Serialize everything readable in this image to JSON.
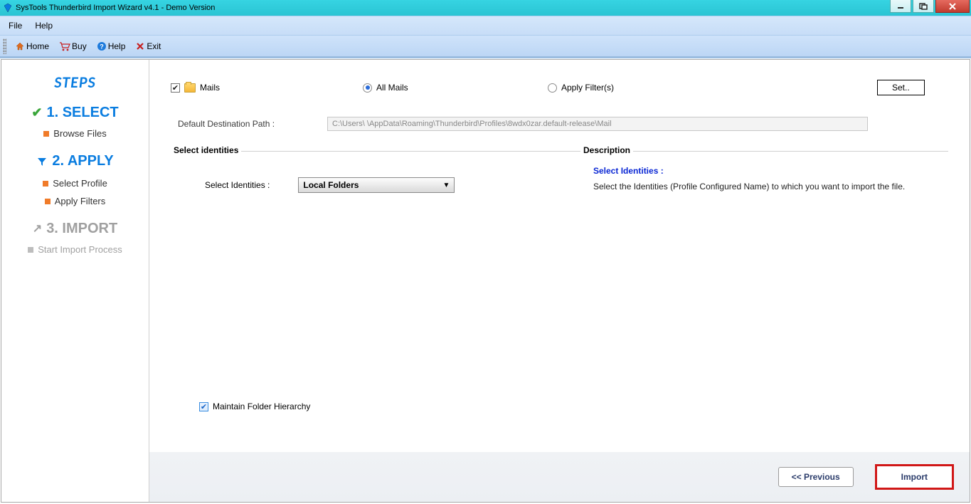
{
  "window": {
    "title": "SysTools Thunderbird Import Wizard v4.1 - Demo Version"
  },
  "menu": {
    "file": "File",
    "help": "Help"
  },
  "toolbar": {
    "home": "Home",
    "buy": "Buy",
    "help": "Help",
    "exit": "Exit"
  },
  "sidebar": {
    "steps_title": "STEPS",
    "step1": {
      "label": "1. SELECT",
      "sub1": "Browse Files"
    },
    "step2": {
      "label": "2. APPLY",
      "sub1": "Select Profile",
      "sub2": "Apply Filters"
    },
    "step3": {
      "label": "3. IMPORT",
      "sub1": "Start Import Process"
    }
  },
  "options": {
    "mails": "Mails",
    "all_mails": "All Mails",
    "apply_filters": "Apply Filter(s)",
    "set": "Set.."
  },
  "dest": {
    "label": "Default Destination Path :",
    "value": "C:\\Users\\        \\AppData\\Roaming\\Thunderbird\\Profiles\\8wdx0zar.default-release\\Mail"
  },
  "identities": {
    "legend": "Select identities",
    "label": "Select Identities :",
    "combo": "Local Folders"
  },
  "description": {
    "legend": "Description",
    "title": "Select Identities :",
    "body": "Select the Identities (Profile Configured Name) to  which  you want to import the file."
  },
  "maintain": "Maintain Folder Hierarchy",
  "footer": {
    "prev": "<< Previous",
    "import": "Import"
  }
}
